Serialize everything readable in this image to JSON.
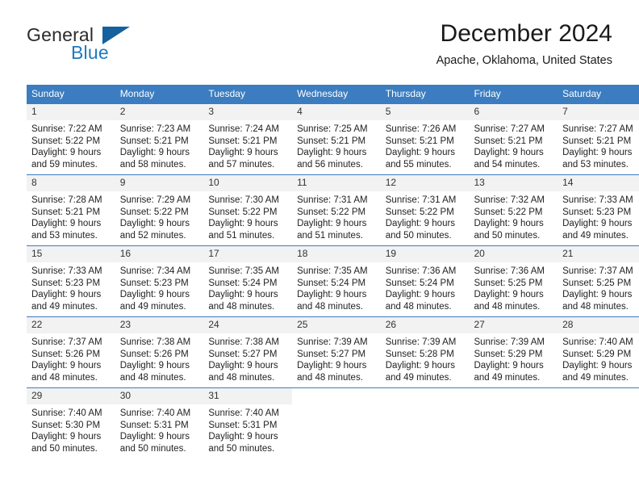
{
  "brand": {
    "name_top": "General",
    "name_bottom": "Blue",
    "accent_color": "#14619e",
    "blue_text_color": "#1f7ac1"
  },
  "header": {
    "title": "December 2024",
    "subtitle": "Apache, Oklahoma, United States"
  },
  "theme": {
    "header_bg": "#3b7dc0",
    "daynum_bg": "#f2f2f2",
    "text": "#222222"
  },
  "weekday_headers": [
    "Sunday",
    "Monday",
    "Tuesday",
    "Wednesday",
    "Thursday",
    "Friday",
    "Saturday"
  ],
  "labels": {
    "sunrise_prefix": "Sunrise:",
    "sunset_prefix": "Sunset:",
    "daylight_prefix": "Daylight:"
  },
  "weeks": [
    [
      {
        "day": "1",
        "sunrise": "Sunrise: 7:22 AM",
        "sunset": "Sunset: 5:22 PM",
        "daylight_1": "Daylight: 9 hours",
        "daylight_2": "and 59 minutes."
      },
      {
        "day": "2",
        "sunrise": "Sunrise: 7:23 AM",
        "sunset": "Sunset: 5:21 PM",
        "daylight_1": "Daylight: 9 hours",
        "daylight_2": "and 58 minutes."
      },
      {
        "day": "3",
        "sunrise": "Sunrise: 7:24 AM",
        "sunset": "Sunset: 5:21 PM",
        "daylight_1": "Daylight: 9 hours",
        "daylight_2": "and 57 minutes."
      },
      {
        "day": "4",
        "sunrise": "Sunrise: 7:25 AM",
        "sunset": "Sunset: 5:21 PM",
        "daylight_1": "Daylight: 9 hours",
        "daylight_2": "and 56 minutes."
      },
      {
        "day": "5",
        "sunrise": "Sunrise: 7:26 AM",
        "sunset": "Sunset: 5:21 PM",
        "daylight_1": "Daylight: 9 hours",
        "daylight_2": "and 55 minutes."
      },
      {
        "day": "6",
        "sunrise": "Sunrise: 7:27 AM",
        "sunset": "Sunset: 5:21 PM",
        "daylight_1": "Daylight: 9 hours",
        "daylight_2": "and 54 minutes."
      },
      {
        "day": "7",
        "sunrise": "Sunrise: 7:27 AM",
        "sunset": "Sunset: 5:21 PM",
        "daylight_1": "Daylight: 9 hours",
        "daylight_2": "and 53 minutes."
      }
    ],
    [
      {
        "day": "8",
        "sunrise": "Sunrise: 7:28 AM",
        "sunset": "Sunset: 5:21 PM",
        "daylight_1": "Daylight: 9 hours",
        "daylight_2": "and 53 minutes."
      },
      {
        "day": "9",
        "sunrise": "Sunrise: 7:29 AM",
        "sunset": "Sunset: 5:22 PM",
        "daylight_1": "Daylight: 9 hours",
        "daylight_2": "and 52 minutes."
      },
      {
        "day": "10",
        "sunrise": "Sunrise: 7:30 AM",
        "sunset": "Sunset: 5:22 PM",
        "daylight_1": "Daylight: 9 hours",
        "daylight_2": "and 51 minutes."
      },
      {
        "day": "11",
        "sunrise": "Sunrise: 7:31 AM",
        "sunset": "Sunset: 5:22 PM",
        "daylight_1": "Daylight: 9 hours",
        "daylight_2": "and 51 minutes."
      },
      {
        "day": "12",
        "sunrise": "Sunrise: 7:31 AM",
        "sunset": "Sunset: 5:22 PM",
        "daylight_1": "Daylight: 9 hours",
        "daylight_2": "and 50 minutes."
      },
      {
        "day": "13",
        "sunrise": "Sunrise: 7:32 AM",
        "sunset": "Sunset: 5:22 PM",
        "daylight_1": "Daylight: 9 hours",
        "daylight_2": "and 50 minutes."
      },
      {
        "day": "14",
        "sunrise": "Sunrise: 7:33 AM",
        "sunset": "Sunset: 5:23 PM",
        "daylight_1": "Daylight: 9 hours",
        "daylight_2": "and 49 minutes."
      }
    ],
    [
      {
        "day": "15",
        "sunrise": "Sunrise: 7:33 AM",
        "sunset": "Sunset: 5:23 PM",
        "daylight_1": "Daylight: 9 hours",
        "daylight_2": "and 49 minutes."
      },
      {
        "day": "16",
        "sunrise": "Sunrise: 7:34 AM",
        "sunset": "Sunset: 5:23 PM",
        "daylight_1": "Daylight: 9 hours",
        "daylight_2": "and 49 minutes."
      },
      {
        "day": "17",
        "sunrise": "Sunrise: 7:35 AM",
        "sunset": "Sunset: 5:24 PM",
        "daylight_1": "Daylight: 9 hours",
        "daylight_2": "and 48 minutes."
      },
      {
        "day": "18",
        "sunrise": "Sunrise: 7:35 AM",
        "sunset": "Sunset: 5:24 PM",
        "daylight_1": "Daylight: 9 hours",
        "daylight_2": "and 48 minutes."
      },
      {
        "day": "19",
        "sunrise": "Sunrise: 7:36 AM",
        "sunset": "Sunset: 5:24 PM",
        "daylight_1": "Daylight: 9 hours",
        "daylight_2": "and 48 minutes."
      },
      {
        "day": "20",
        "sunrise": "Sunrise: 7:36 AM",
        "sunset": "Sunset: 5:25 PM",
        "daylight_1": "Daylight: 9 hours",
        "daylight_2": "and 48 minutes."
      },
      {
        "day": "21",
        "sunrise": "Sunrise: 7:37 AM",
        "sunset": "Sunset: 5:25 PM",
        "daylight_1": "Daylight: 9 hours",
        "daylight_2": "and 48 minutes."
      }
    ],
    [
      {
        "day": "22",
        "sunrise": "Sunrise: 7:37 AM",
        "sunset": "Sunset: 5:26 PM",
        "daylight_1": "Daylight: 9 hours",
        "daylight_2": "and 48 minutes."
      },
      {
        "day": "23",
        "sunrise": "Sunrise: 7:38 AM",
        "sunset": "Sunset: 5:26 PM",
        "daylight_1": "Daylight: 9 hours",
        "daylight_2": "and 48 minutes."
      },
      {
        "day": "24",
        "sunrise": "Sunrise: 7:38 AM",
        "sunset": "Sunset: 5:27 PM",
        "daylight_1": "Daylight: 9 hours",
        "daylight_2": "and 48 minutes."
      },
      {
        "day": "25",
        "sunrise": "Sunrise: 7:39 AM",
        "sunset": "Sunset: 5:27 PM",
        "daylight_1": "Daylight: 9 hours",
        "daylight_2": "and 48 minutes."
      },
      {
        "day": "26",
        "sunrise": "Sunrise: 7:39 AM",
        "sunset": "Sunset: 5:28 PM",
        "daylight_1": "Daylight: 9 hours",
        "daylight_2": "and 49 minutes."
      },
      {
        "day": "27",
        "sunrise": "Sunrise: 7:39 AM",
        "sunset": "Sunset: 5:29 PM",
        "daylight_1": "Daylight: 9 hours",
        "daylight_2": "and 49 minutes."
      },
      {
        "day": "28",
        "sunrise": "Sunrise: 7:40 AM",
        "sunset": "Sunset: 5:29 PM",
        "daylight_1": "Daylight: 9 hours",
        "daylight_2": "and 49 minutes."
      }
    ],
    [
      {
        "day": "29",
        "sunrise": "Sunrise: 7:40 AM",
        "sunset": "Sunset: 5:30 PM",
        "daylight_1": "Daylight: 9 hours",
        "daylight_2": "and 50 minutes."
      },
      {
        "day": "30",
        "sunrise": "Sunrise: 7:40 AM",
        "sunset": "Sunset: 5:31 PM",
        "daylight_1": "Daylight: 9 hours",
        "daylight_2": "and 50 minutes."
      },
      {
        "day": "31",
        "sunrise": "Sunrise: 7:40 AM",
        "sunset": "Sunset: 5:31 PM",
        "daylight_1": "Daylight: 9 hours",
        "daylight_2": "and 50 minutes."
      },
      {
        "day": "",
        "sunrise": "",
        "sunset": "",
        "daylight_1": "",
        "daylight_2": ""
      },
      {
        "day": "",
        "sunrise": "",
        "sunset": "",
        "daylight_1": "",
        "daylight_2": ""
      },
      {
        "day": "",
        "sunrise": "",
        "sunset": "",
        "daylight_1": "",
        "daylight_2": ""
      },
      {
        "day": "",
        "sunrise": "",
        "sunset": "",
        "daylight_1": "",
        "daylight_2": ""
      }
    ]
  ]
}
